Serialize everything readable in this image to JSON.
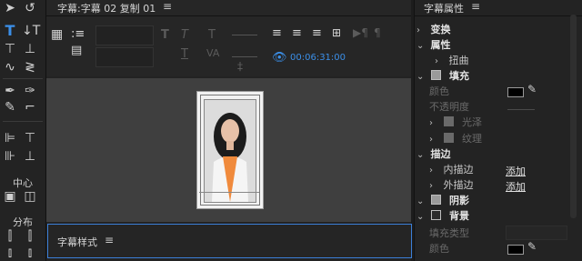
{
  "titler_tab": {
    "title": "字幕:字幕 02 复制 01",
    "menu_icon": "hamburger-icon"
  },
  "properties_panel": {
    "title": "字幕属性",
    "menu_icon": "hamburger-icon",
    "sections": {
      "transform": "变换",
      "properties": "属性",
      "distort": "扭曲",
      "fill": "填充",
      "color": "颜色",
      "opacity": "不透明度",
      "sheen": "光泽",
      "texture": "纹理",
      "strokes": "描边",
      "inner_stroke": "内描边",
      "outer_stroke": "外描边",
      "add": "添加",
      "shadow": "阴影",
      "background": "背景",
      "fill_type": "填充类型",
      "bg_color": "颜色"
    }
  },
  "tools_panel": {
    "center_label": "中心",
    "distribute_label": "分布"
  },
  "toolbar": {
    "timecode": "00:06:31:00"
  },
  "styles_panel": {
    "title": "字幕样式",
    "menu_icon": "hamburger-icon"
  },
  "colors": {
    "accent": "#3b8fe8",
    "timecode": "#3b8fe8",
    "canvas": "#3f3f3f",
    "border_blue": "#3b7fd8"
  }
}
